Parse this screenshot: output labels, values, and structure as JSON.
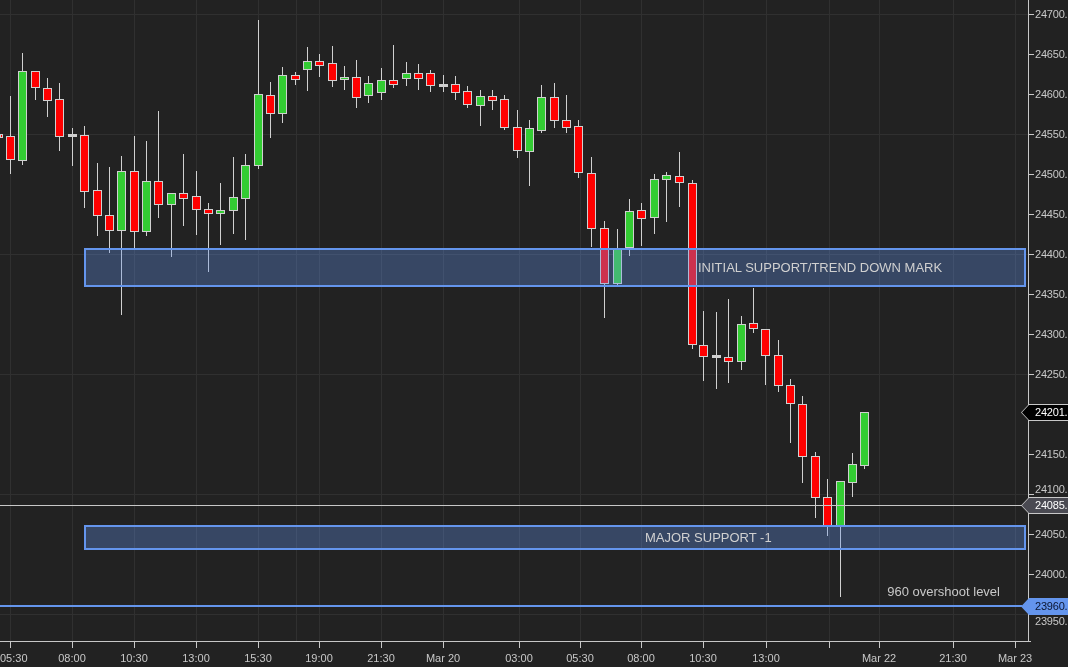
{
  "chart": {
    "y_axis": {
      "labels": [
        "24700.",
        "24650.",
        "24600.",
        "24550.",
        "24500.",
        "24450.",
        "24400.",
        "24350.",
        "24300.",
        "24250.",
        "24150.",
        "24100.",
        "24050.",
        "24000.",
        "23950."
      ]
    },
    "x_axis": {
      "labels": [
        "05:30",
        "08:00",
        "10:30",
        "13:00",
        "15:30",
        "19:00",
        "21:30",
        "Mar 20",
        "03:00",
        "05:30",
        "08:00",
        "10:30",
        "13:00",
        "Mar 22",
        "21:30",
        "Mar 23"
      ]
    },
    "zones": [
      {
        "label": "INITIAL SUPPORT/TREND DOWN MARK"
      },
      {
        "label": "MAJOR SUPPORT -1"
      }
    ],
    "price_lines": [
      {
        "kind": "current",
        "price": "24201."
      },
      {
        "kind": "level",
        "price": "24085."
      },
      {
        "kind": "alert",
        "price": "23960.",
        "note": "960 overshoot level"
      }
    ]
  }
}
